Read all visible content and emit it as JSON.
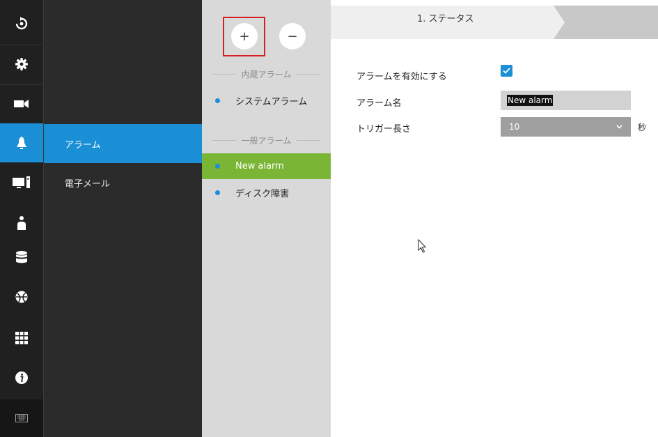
{
  "rail": {
    "items": [
      {
        "icon": "logo-icon"
      },
      {
        "icon": "gear-icon"
      },
      {
        "icon": "camera-icon"
      },
      {
        "icon": "bell-icon",
        "active": true
      },
      {
        "icon": "monitor-icon"
      },
      {
        "icon": "user-icon"
      },
      {
        "icon": "database-icon"
      },
      {
        "icon": "globe-icon"
      },
      {
        "icon": "grid-icon"
      },
      {
        "icon": "info-icon"
      },
      {
        "icon": "keyboard-icon"
      }
    ],
    "active_color": "#1a8fd6"
  },
  "submenu": {
    "items": [
      {
        "label": "アラーム",
        "active": true
      },
      {
        "label": "電子メール"
      }
    ]
  },
  "list": {
    "add_label": "+",
    "remove_label": "−",
    "builtin_header": "内蔵アラーム",
    "builtin_items": [
      "システムアラーム"
    ],
    "general_header": "一般アラーム",
    "general_items": [
      "New alarm",
      "ディスク障害"
    ],
    "selected_color": "#7ab535"
  },
  "main": {
    "step_label": "1. ステータス",
    "enable_label": "アラームを有効にする",
    "enable_checked": true,
    "name_label": "アラーム名",
    "name_value": "New alarm",
    "trigger_label": "トリガー長さ",
    "trigger_value": "10",
    "trigger_unit": "秒"
  }
}
